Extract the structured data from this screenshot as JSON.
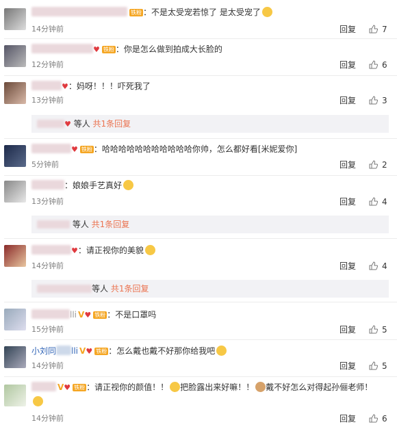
{
  "comments": [
    {
      "text": "：不是太受宠若惊了 是太受宠了",
      "time": "14分钟前",
      "reply": "回复",
      "likes": "7",
      "badge": "铁粉"
    },
    {
      "text": "：你是怎么做到拍成大长脸的",
      "time": "12分钟前",
      "reply": "回复",
      "likes": "6",
      "badge": "铁粉"
    },
    {
      "text": "：妈呀！！！吓死我了",
      "time": "13分钟前",
      "reply": "回复",
      "likes": "3"
    },
    {
      "text": "：哈哈哈哈哈哈哈哈哈哈哈你帅，怎么都好看[米妮爱你]",
      "time": "5分钟前",
      "reply": "回复",
      "likes": "2",
      "badge": "铁粉"
    },
    {
      "text": "：娘娘手艺真好",
      "time": "13分钟前",
      "reply": "回复",
      "likes": "4"
    },
    {
      "text": "：请正视你的美貌",
      "time": "14分钟前",
      "reply": "回复",
      "likes": "4"
    },
    {
      "name_suffix": "lli",
      "text": "：不是口罩吗",
      "time": "15分钟前",
      "reply": "回复",
      "likes": "5",
      "badge": "铁粉"
    },
    {
      "name_prefix": "小刘同",
      "name_suffix": "lli",
      "text": "：怎么戴也戴不好那你给我吧",
      "time": "14分钟前",
      "reply": "回复",
      "likes": "5",
      "badge": "铁粉"
    },
    {
      "text": "：请正视你的颜值！！",
      "text2": "把脸露出来好嘛！！",
      "text3": "戴不好怎么对得起孙俪老师！",
      "time": "14分钟前",
      "reply": "回复",
      "likes": "6",
      "badge": "铁粉"
    }
  ],
  "subreplies": [
    {
      "suffix": "等人",
      "count": "共1条回复"
    },
    {
      "suffix": "等人",
      "count": "共1条回复"
    },
    {
      "suffix": "等人",
      "count": "共1条回复"
    }
  ],
  "colors": {
    "accent_orange": "#eb7350",
    "badge": "#f5a623",
    "name_blue": "#2f63b6"
  }
}
